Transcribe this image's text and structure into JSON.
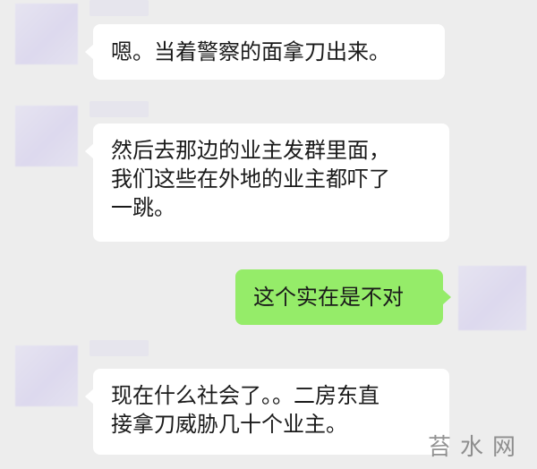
{
  "chat": {
    "messages": [
      {
        "sender": "other",
        "text": "嗯。当着警察的面拿刀出来。"
      },
      {
        "sender": "other",
        "text": "然后去那边的业主发群里面，\n我们这些在外地的业主都吓了\n一跳。"
      },
      {
        "sender": "self",
        "text": "这个实在是不对"
      },
      {
        "sender": "other",
        "text": "现在什么社会了。。二房东直\n接拿刀威胁几十个业主。"
      }
    ]
  },
  "watermark": {
    "text": "苔水网"
  },
  "colors": {
    "background": "#ededed",
    "incoming_bubble": "#ffffff",
    "outgoing_bubble": "#95ec69"
  }
}
